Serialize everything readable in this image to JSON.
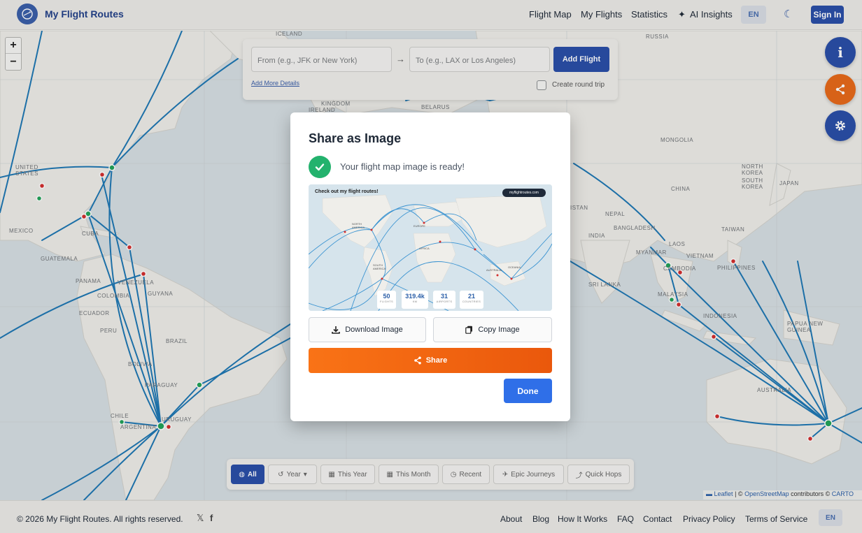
{
  "app": {
    "brand": "My Flight Routes"
  },
  "nav": {
    "flight_map": "Flight Map",
    "my_flights": "My Flights",
    "statistics": "Statistics",
    "ai_insights": "AI Insights",
    "lang": "EN",
    "sign_in": "Sign In"
  },
  "map": {
    "zoom_in": "+",
    "zoom_out": "−",
    "labels": {
      "iceland": "ICELAND",
      "russia": "RUSSIA",
      "kingdom": "KINGDOM",
      "ireland": "IRELAND",
      "belarus": "BELARUS",
      "mongolia": "MONGOLIA",
      "united_states": "UNITED STATES",
      "north_korea": "NORTH KOREA",
      "south_korea": "SOUTH KOREA",
      "japan": "JAPAN",
      "china": "CHINA",
      "istan": "ISTAN",
      "nepal": "NEPAL",
      "bangladesh": "BANGLADESH",
      "india": "INDIA",
      "taiwan": "TAIWAN",
      "myanmar": "MYANMAR",
      "laos": "LAOS",
      "vietnam": "VIETNAM",
      "cambodia": "CAMBODIA",
      "philippines": "PHILIPPINES",
      "sri_lanka": "SRI LANKA",
      "malaysia": "MALAYSIA",
      "indonesia": "INDONESIA",
      "papua_new_guinea": "PAPUA NEW GUINEA",
      "australia": "AUSTRALIA",
      "mexico": "MEXICO",
      "cuba": "CUBA",
      "guatemala": "GUATEMALA",
      "panama": "PANAMA",
      "venezuela": "VENEZUELA",
      "colombia": "COLOMBIA",
      "guyana": "GUYANA",
      "ecuador": "ECUADOR",
      "peru": "PERU",
      "brazil": "BRAZIL",
      "bolivia": "BOLIVIA",
      "paraguay": "PARAGUAY",
      "chile": "CHILE",
      "argentina": "ARGENTINA",
      "uruguay": "URUGUAY"
    }
  },
  "search_panel": {
    "from_placeholder": "From (e.g., JFK or New York)",
    "to_placeholder": "To (e.g., LAX or Los Angeles)",
    "arrow": "→",
    "add_flight": "Add Flight",
    "add_more": "Add More Details",
    "round_trip": "Create round trip"
  },
  "fabs": {
    "info": "i"
  },
  "filters": {
    "all": "All",
    "year": "Year",
    "this_year": "This Year",
    "this_month": "This Month",
    "recent": "Recent",
    "epic": "Epic Journeys",
    "quick": "Quick Hops"
  },
  "attribution": {
    "leaflet": "Leaflet",
    "sep": "| ©",
    "osm": "OpenStreetMap",
    "contrib": "contributors ©",
    "carto": "CARTO"
  },
  "modal": {
    "title": "Share as Image",
    "ready": "Your flight map image is ready!",
    "preview": {
      "heading": "Check out my flight routes!",
      "badge": "myflightroutes.com",
      "labels": {
        "north_america": "NORTH AMERICA",
        "europe": "EUROPE",
        "africa": "AFRICA",
        "south_america": "SOUTH AMERICA",
        "australia": "AUSTRALIA",
        "oceania": "OCEANIA"
      },
      "stats": [
        {
          "value": "50",
          "label": "FLIGHTS"
        },
        {
          "value": "319.4k",
          "label": "KM"
        },
        {
          "value": "31",
          "label": "AIRPORTS"
        },
        {
          "value": "21",
          "label": "COUNTRIES"
        }
      ]
    },
    "download": "Download Image",
    "copy": "Copy Image",
    "share": "Share",
    "done": "Done"
  },
  "footer": {
    "copyright": "© 2026 My Flight Routes. All rights reserved.",
    "x_icon": "𝕏",
    "fb_icon": "f",
    "links": {
      "about": "About",
      "blog": "Blog",
      "how": "How It Works",
      "faq": "FAQ",
      "contact": "Contact",
      "privacy": "Privacy Policy",
      "terms": "Terms of Service"
    },
    "lang": "EN"
  },
  "colors": {
    "brand": "#2b4fa8",
    "route": "#1f78b4",
    "share_orange": "#f97316",
    "success": "#23b26d",
    "done_blue": "#2f6fe8"
  }
}
